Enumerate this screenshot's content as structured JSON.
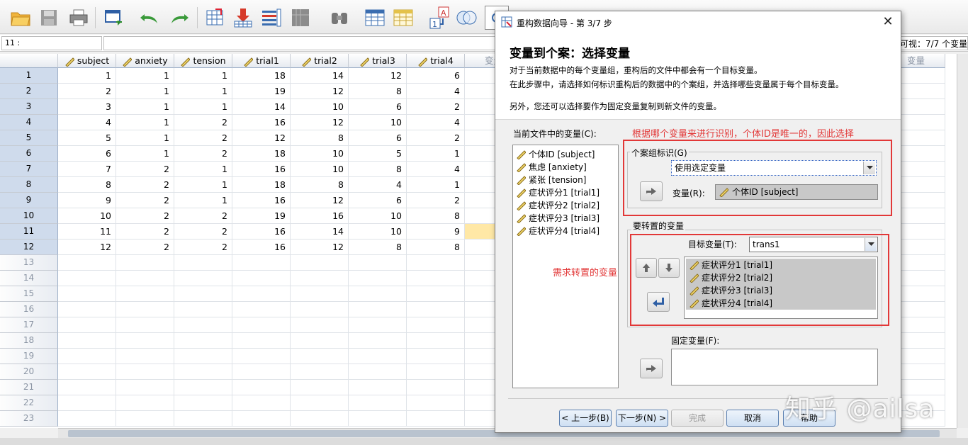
{
  "cellbar": {
    "ref": "11 :",
    "value": ""
  },
  "visible_info": "可视：7/7 个变量",
  "grid": {
    "columns": [
      "subject",
      "anxiety",
      "tension",
      "trial1",
      "trial2",
      "trial3",
      "trial4",
      "变量"
    ],
    "right_column": "变量",
    "rows": [
      [
        1,
        1,
        1,
        18,
        14,
        12,
        6
      ],
      [
        2,
        1,
        1,
        19,
        12,
        8,
        4
      ],
      [
        3,
        1,
        1,
        14,
        10,
        6,
        2
      ],
      [
        4,
        1,
        2,
        16,
        12,
        10,
        4
      ],
      [
        5,
        1,
        2,
        12,
        8,
        6,
        2
      ],
      [
        6,
        1,
        2,
        18,
        10,
        5,
        1
      ],
      [
        7,
        2,
        1,
        16,
        10,
        8,
        4
      ],
      [
        8,
        2,
        1,
        18,
        8,
        4,
        1
      ],
      [
        9,
        2,
        1,
        16,
        12,
        6,
        2
      ],
      [
        10,
        2,
        2,
        19,
        16,
        10,
        8
      ],
      [
        11,
        2,
        2,
        16,
        14,
        10,
        9
      ],
      [
        12,
        2,
        2,
        16,
        12,
        8,
        8
      ]
    ],
    "row_numbers": [
      "1",
      "2",
      "3",
      "4",
      "5",
      "6",
      "7",
      "8",
      "9",
      "10",
      "11",
      "12",
      "13",
      "14",
      "15",
      "16",
      "17",
      "18",
      "19",
      "20",
      "21",
      "22",
      "23"
    ]
  },
  "dialog": {
    "title": "重构数据向导 - 第 3/7 步",
    "heading": "变量到个案：选择变量",
    "desc1": "对于当前数据中的每个变量组，重构后的文件中都会有一个目标变量。",
    "desc2": "在此步骤中，请选择如何标识重构后的数据中的个案组，并选择哪些变量属于每个目标变量。",
    "desc3": "另外，您还可以选择要作为固定变量复制到新文件的变量。",
    "current_vars_label": "当前文件中的变量(C):",
    "current_vars": [
      "个体ID [subject]",
      "焦虑 [anxiety]",
      "紧张 [tension]",
      "症状评分1 [trial1]",
      "症状评分2 [trial2]",
      "症状评分3 [trial3]",
      "症状评分4 [trial4]"
    ],
    "case_group_label": "个案组标识(G)",
    "case_group_value": "使用选定变量",
    "variable_label": "变量(R):",
    "variable_value": "个体ID [subject]",
    "transpose_label": "要转置的变量",
    "target_label": "目标变量(T):",
    "target_value": "trans1",
    "transpose_vars": [
      "症状评分1 [trial1]",
      "症状评分2 [trial2]",
      "症状评分3 [trial3]",
      "症状评分4 [trial4]"
    ],
    "fixed_label": "固定变量(F):",
    "buttons": {
      "back": "< 上一步(B)",
      "next": "下一步(N) >",
      "finish": "完成",
      "cancel": "取消",
      "help": "帮助"
    }
  },
  "annotations": {
    "top": "根据哪个变量来进行识别，个体ID是唯一的，因此选择",
    "left": "需求转置的变量"
  },
  "watermark": "知乎 @ailsa",
  "colors": {
    "annotation": "#e23838",
    "selected_row": "#cfdbec",
    "highlight_cell": "#ffe8a6"
  }
}
